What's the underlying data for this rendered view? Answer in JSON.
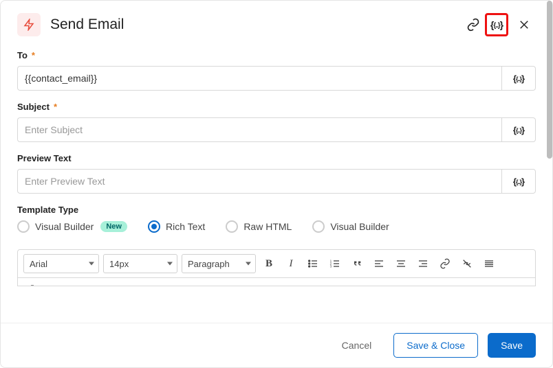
{
  "header": {
    "title": "Send Email"
  },
  "fields": {
    "to": {
      "label": "To",
      "required": "*",
      "value": "{{contact_email}}"
    },
    "subject": {
      "label": "Subject",
      "required": "*",
      "placeholder": "Enter Subject",
      "value": ""
    },
    "preview": {
      "label": "Preview Text",
      "placeholder": "Enter Preview Text",
      "value": ""
    },
    "templateType": {
      "label": "Template Type",
      "options": [
        {
          "label": "Visual Builder",
          "selected": false,
          "badge": "New"
        },
        {
          "label": "Rich Text",
          "selected": true
        },
        {
          "label": "Raw HTML",
          "selected": false
        },
        {
          "label": "Visual Builder",
          "selected": false
        }
      ]
    }
  },
  "editor": {
    "font": "Arial",
    "size": "14px",
    "block": "Paragraph"
  },
  "mergeGlyph": "{{..}}",
  "mergeGlyphSmall": "{[..}}",
  "footer": {
    "cancel": "Cancel",
    "saveClose": "Save & Close",
    "save": "Save"
  }
}
